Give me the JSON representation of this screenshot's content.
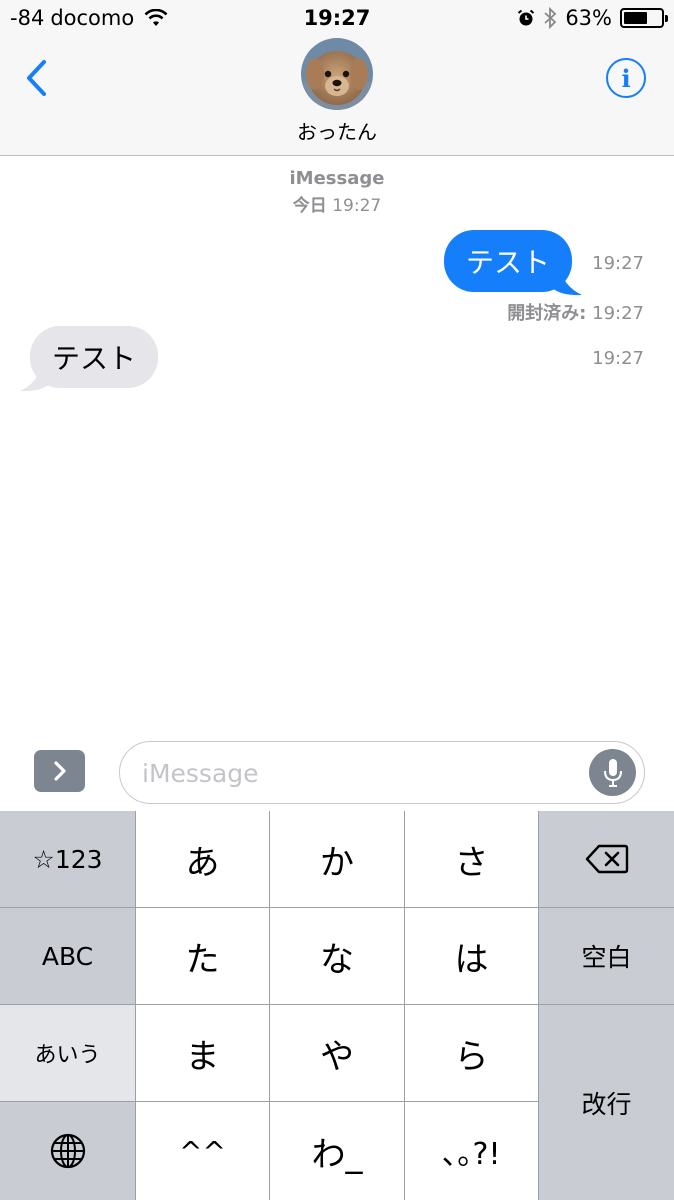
{
  "status_bar": {
    "signal": "-84",
    "carrier": "docomo",
    "time": "19:27",
    "battery_percent": "63%",
    "battery_level": 0.63,
    "icons": [
      "wifi-icon",
      "alarm-icon",
      "bluetooth-icon",
      "battery-icon"
    ]
  },
  "header": {
    "contact_name": "おったん",
    "back_icon": "chevron-left-icon",
    "info_icon": "info-icon",
    "info_glyph": "i",
    "accent_color": "#157efb"
  },
  "conversation": {
    "service": "iMessage",
    "date_day": "今日",
    "date_time": "19:27",
    "messages": [
      {
        "direction": "outgoing",
        "text": "テスト",
        "time": "19:27",
        "bubble_color": "#157efb"
      },
      {
        "direction": "incoming",
        "text": "テスト",
        "time": "19:27",
        "bubble_color": "#e5e5ea"
      }
    ],
    "read_receipt_label": "開封済み:",
    "read_receipt_time": "19:27"
  },
  "input_bar": {
    "placeholder": "iMessage",
    "value": "",
    "apps_icon": "chevron-right-icon",
    "mic_icon": "microphone-icon"
  },
  "keyboard": {
    "mode_number": "☆123",
    "mode_abc": "ABC",
    "mode_kana": "あいう",
    "row1": [
      "あ",
      "か",
      "さ"
    ],
    "row2": [
      "た",
      "な",
      "は"
    ],
    "row3": [
      "ま",
      "や",
      "ら"
    ],
    "row4": [
      "^^",
      "わ_",
      "､｡?!"
    ],
    "space": "空白",
    "return": "改行",
    "delete_icon": "backspace-icon",
    "globe_icon": "globe-icon"
  }
}
